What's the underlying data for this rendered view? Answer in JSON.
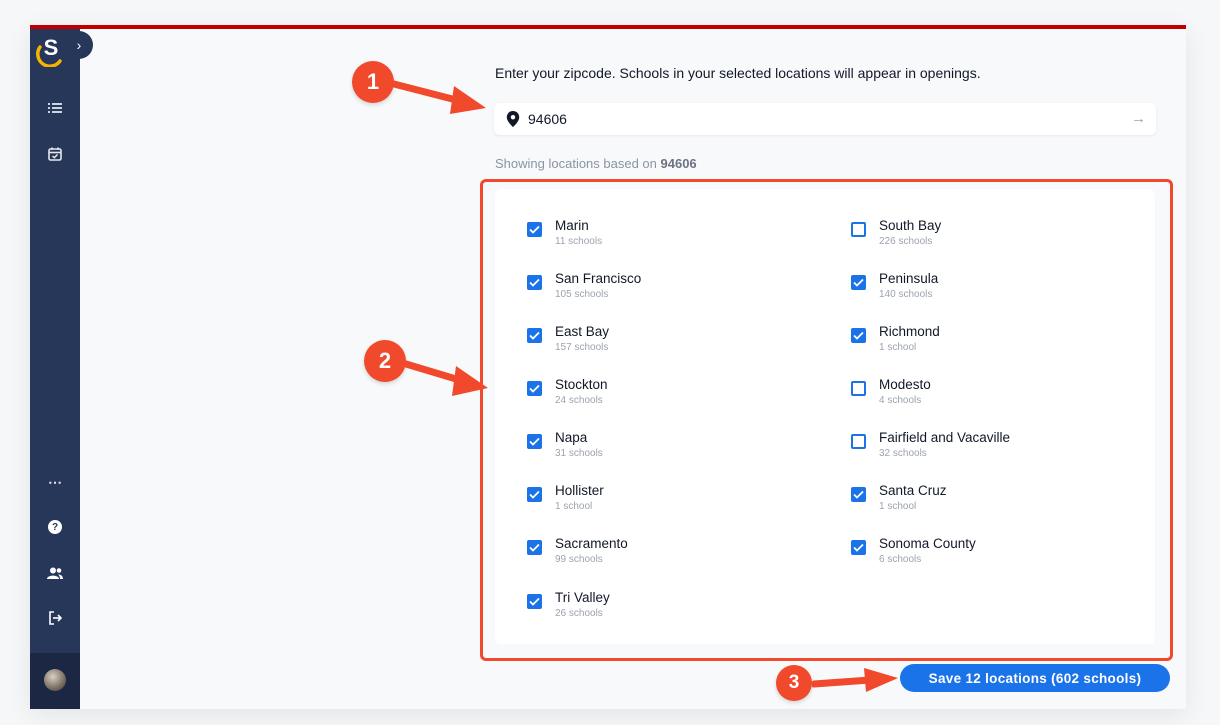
{
  "sidebar": {
    "logo_letter": "S",
    "expand_glyph": "›",
    "items": [
      {
        "icon": "list-icon"
      },
      {
        "icon": "calendar-check-icon"
      },
      {
        "icon": "more-dots-icon",
        "glyph": "⋯"
      },
      {
        "icon": "help-icon",
        "glyph": "?"
      },
      {
        "icon": "people-icon"
      },
      {
        "icon": "logout-icon"
      },
      {
        "icon": "avatar"
      }
    ]
  },
  "zip": {
    "prompt": "Enter your zipcode. Schools in your selected locations will appear in openings.",
    "value": "94606",
    "submit_glyph": "→"
  },
  "showing": {
    "prefix": "Showing locations based on ",
    "zip": "94606"
  },
  "locations": {
    "left": [
      {
        "name": "Marin",
        "count": "11 schools",
        "checked": true
      },
      {
        "name": "San Francisco",
        "count": "105 schools",
        "checked": true
      },
      {
        "name": "East Bay",
        "count": "157 schools",
        "checked": true
      },
      {
        "name": "Stockton",
        "count": "24 schools",
        "checked": true
      },
      {
        "name": "Napa",
        "count": "31 schools",
        "checked": true
      },
      {
        "name": "Hollister",
        "count": "1 school",
        "checked": true
      },
      {
        "name": "Sacramento",
        "count": "99 schools",
        "checked": true
      },
      {
        "name": "Tri Valley",
        "count": "26 schools",
        "checked": true
      }
    ],
    "right": [
      {
        "name": "South Bay",
        "count": "226 schools",
        "checked": false
      },
      {
        "name": "Peninsula",
        "count": "140 schools",
        "checked": true
      },
      {
        "name": "Richmond",
        "count": "1 school",
        "checked": true
      },
      {
        "name": "Modesto",
        "count": "4 schools",
        "checked": false
      },
      {
        "name": "Fairfield and Vacaville",
        "count": "32 schools",
        "checked": false
      },
      {
        "name": "Santa Cruz",
        "count": "1 school",
        "checked": true
      },
      {
        "name": "Sonoma County",
        "count": "6 schools",
        "checked": true
      }
    ]
  },
  "save_label": "Save 12 locations (602 schools)",
  "annotations": [
    "1",
    "2",
    "3"
  ],
  "colors": {
    "accent": "#1a73e8",
    "annotation": "#f0492c",
    "sidebar": "#26375a",
    "top_bar": "#c00000"
  }
}
